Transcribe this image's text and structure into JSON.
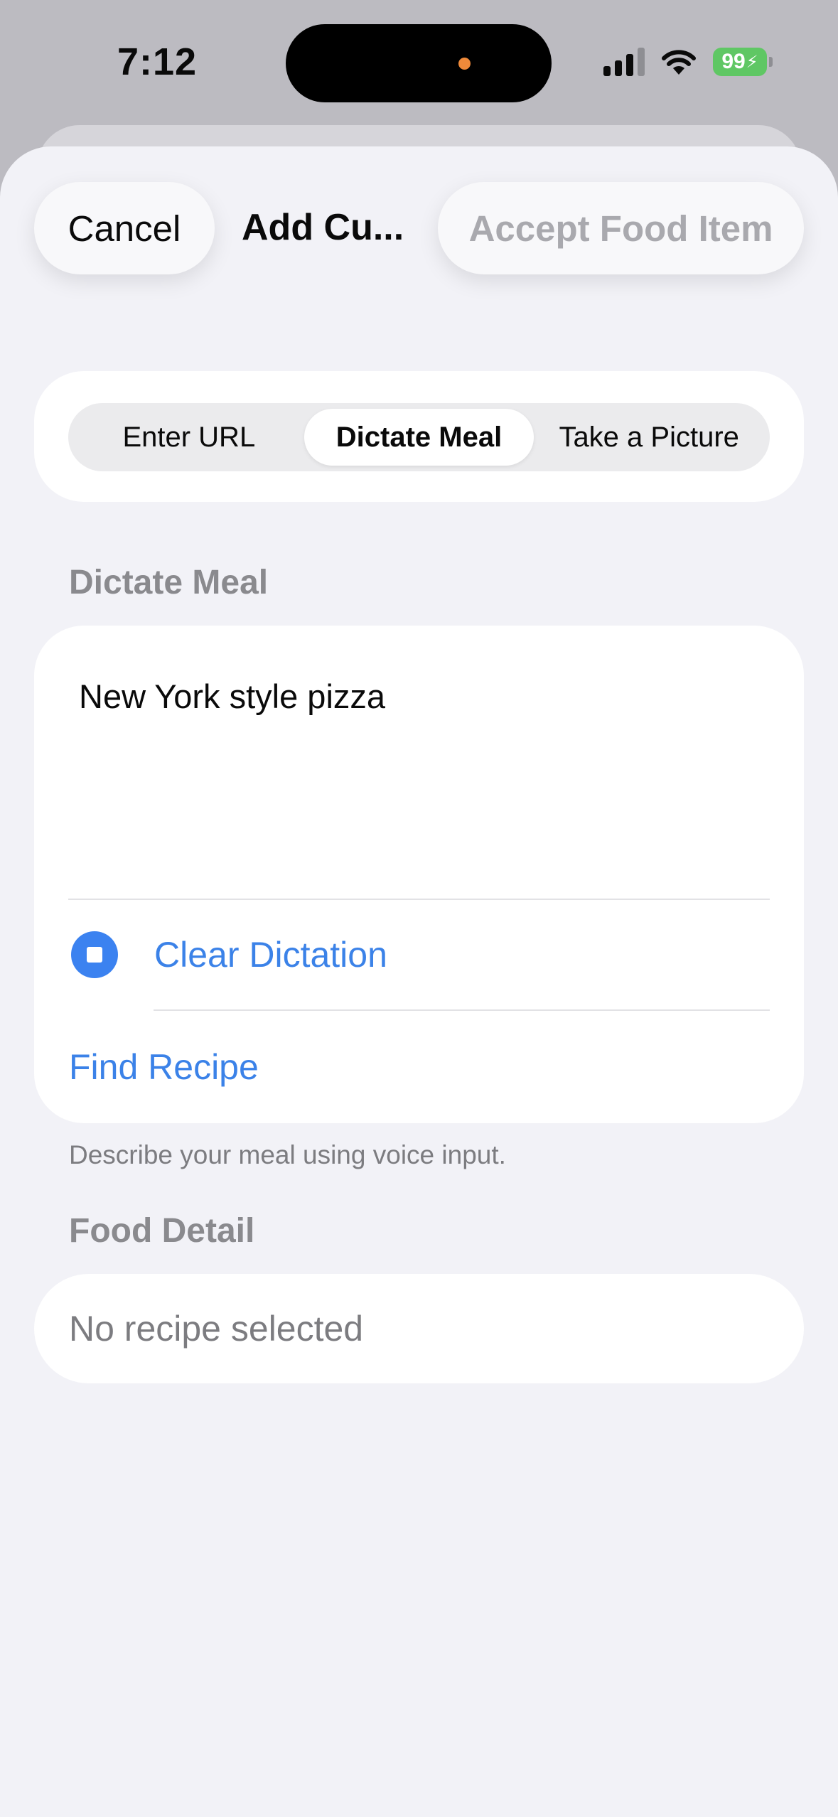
{
  "status_bar": {
    "time": "7:12",
    "battery": "99",
    "icons": [
      "signal-icon",
      "wifi-icon",
      "battery-icon",
      "charging-bolt-icon"
    ]
  },
  "nav": {
    "cancel_label": "Cancel",
    "title": "Add Cu...",
    "accept_label": "Accept Food Item"
  },
  "segments": {
    "options": [
      "Enter URL",
      "Dictate Meal",
      "Take a Picture"
    ],
    "selected": "Dictate Meal"
  },
  "dictate": {
    "header": "Dictate Meal",
    "text": "New York style pizza",
    "clear_label": "Clear Dictation",
    "find_label": "Find Recipe",
    "footer": "Describe your meal using voice input."
  },
  "food_detail": {
    "header": "Food Detail",
    "value": "No recipe selected"
  },
  "colors": {
    "accent": "#3b82e8",
    "battery": "#5fc764",
    "background": "#f2f2f7"
  }
}
